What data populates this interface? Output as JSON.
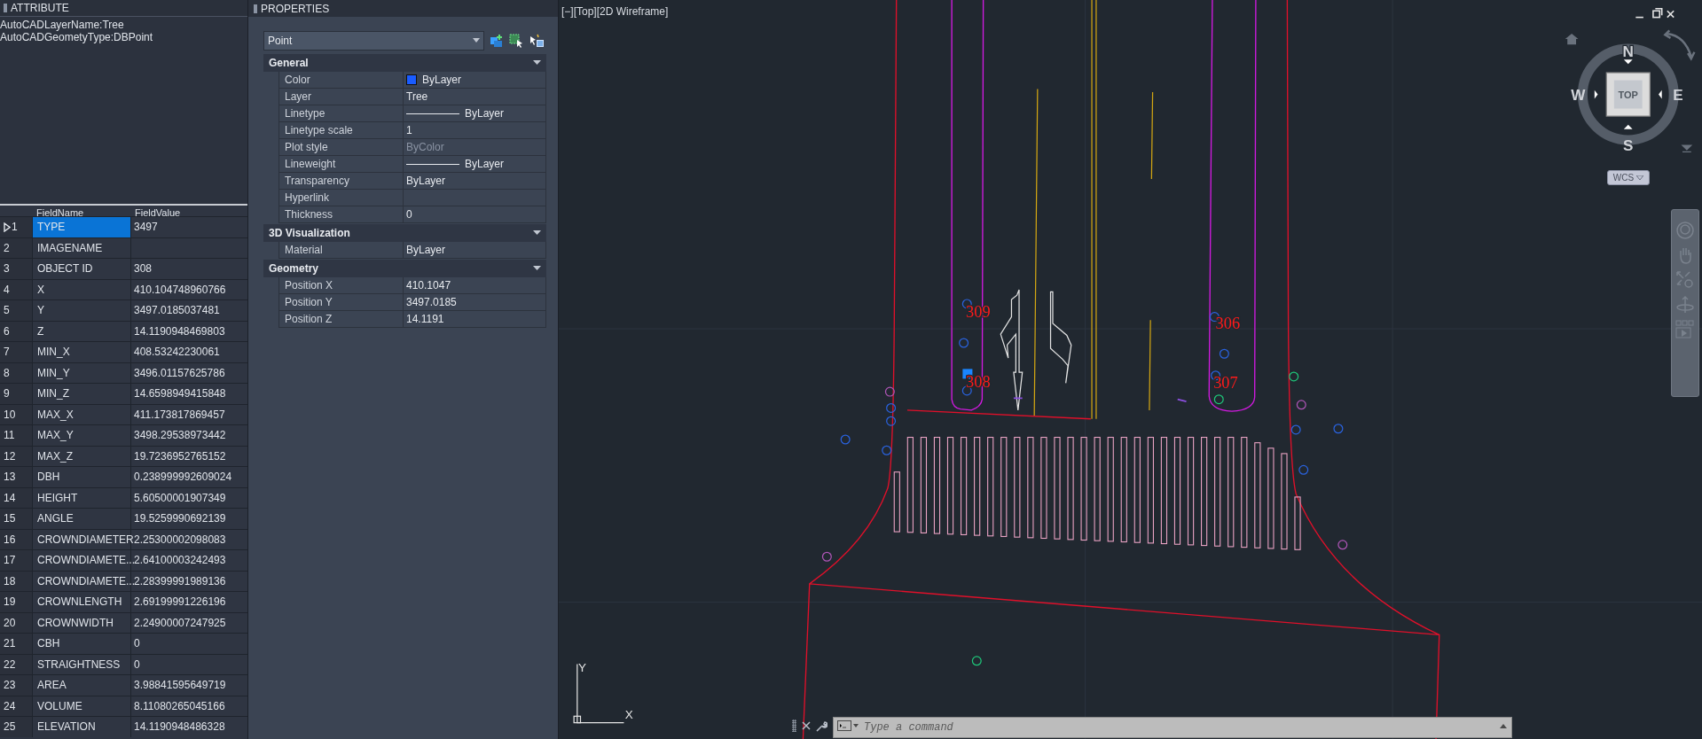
{
  "attribute_panel": {
    "title": "ATTRIBUTE",
    "info_lines": [
      "AutoCADLayerName:Tree",
      "AutoCADGeometyType:DBPoint"
    ],
    "table": {
      "columns": [
        "FieldName",
        "FieldValue"
      ],
      "rows": [
        {
          "number": "1",
          "field_name": "TYPE",
          "field_value": "3497",
          "selected": true
        },
        {
          "number": "2",
          "field_name": "IMAGENAME",
          "selected": false
        },
        {
          "number": "3",
          "field_name": "OBJECT ID",
          "field_value": "308",
          "selected": false
        },
        {
          "number": "4",
          "field_name": "X",
          "field_value": "410.104748960766",
          "selected": false
        },
        {
          "number": "5",
          "field_name": "Y",
          "field_value": "3497.0185037481",
          "selected": false
        },
        {
          "number": "6",
          "field_name": "Z",
          "field_value": "14.1190948469803",
          "selected": false
        },
        {
          "number": "7",
          "field_name": "MIN_X",
          "field_value": "408.53242230061",
          "selected": false
        },
        {
          "number": "8",
          "field_name": "MIN_Y",
          "field_value": "3496.01157625786",
          "selected": false
        },
        {
          "number": "9",
          "field_name": "MIN_Z",
          "field_value": "14.6598949415848",
          "selected": false
        },
        {
          "number": "10",
          "field_name": "MAX_X",
          "field_value": "411.173817869457",
          "selected": false
        },
        {
          "number": "11",
          "field_name": "MAX_Y",
          "field_value": "3498.29538973442",
          "selected": false
        },
        {
          "number": "12",
          "field_name": "MAX_Z",
          "field_value": "19.7236952765152",
          "selected": false
        },
        {
          "number": "13",
          "field_name": "DBH",
          "field_value": "0.238999992609024",
          "selected": false
        },
        {
          "number": "14",
          "field_name": "HEIGHT",
          "field_value": "5.60500001907349",
          "selected": false
        },
        {
          "number": "15",
          "field_name": "ANGLE",
          "field_value": "19.5259990692139",
          "selected": false
        },
        {
          "number": "16",
          "field_name": "CROWNDIAMETER",
          "field_value": "2.25300002098083",
          "selected": false
        },
        {
          "number": "17",
          "field_name": "CROWNDIAMETE...",
          "field_value": "2.64100003242493",
          "selected": false
        },
        {
          "number": "18",
          "field_name": "CROWNDIAMETE...",
          "field_value": "2.28399991989136",
          "selected": false
        },
        {
          "number": "19",
          "field_name": "CROWNLENGTH",
          "field_value": "2.69199991226196",
          "selected": false
        },
        {
          "number": "20",
          "field_name": "CROWNWIDTH",
          "field_value": "2.24900007247925",
          "selected": false
        },
        {
          "number": "21",
          "field_name": "CBH",
          "field_value": "0",
          "selected": false
        },
        {
          "number": "22",
          "field_name": "STRAIGHTNESS",
          "field_value": "0",
          "selected": false
        },
        {
          "number": "23",
          "field_name": "AREA",
          "field_value": "3.98841595649719",
          "selected": false
        },
        {
          "number": "24",
          "field_name": "VOLUME",
          "field_value": "8.11080265045166",
          "selected": false
        },
        {
          "number": "25",
          "field_name": "ELEVATION",
          "field_value": "14.1190948486328",
          "selected": false
        }
      ]
    }
  },
  "properties_panel": {
    "title": "PROPERTIES",
    "object_type": "Point",
    "sections": [
      {
        "title": "General",
        "expanded": true,
        "rows": [
          {
            "kind": "swatch",
            "label": "Color",
            "value": "ByLayer",
            "color": "#1a5cff"
          },
          {
            "kind": "text",
            "label": "Layer",
            "value": "Tree"
          },
          {
            "kind": "line",
            "label": "Linetype",
            "value": "ByLayer"
          },
          {
            "kind": "text",
            "label": "Linetype scale",
            "value": "1"
          },
          {
            "kind": "dimmed",
            "label": "Plot style",
            "value": "ByColor"
          },
          {
            "kind": "line",
            "label": "Lineweight",
            "value": "ByLayer"
          },
          {
            "kind": "text",
            "label": "Transparency",
            "value": "ByLayer"
          },
          {
            "kind": "text",
            "label": "Hyperlink"
          },
          {
            "kind": "text",
            "label": "Thickness",
            "value": "0"
          }
        ]
      },
      {
        "title": "3D Visualization",
        "expanded": true,
        "rows": [
          {
            "kind": "text",
            "label": "Material",
            "value": "ByLayer"
          }
        ]
      },
      {
        "title": "Geometry",
        "expanded": true,
        "rows": [
          {
            "kind": "text",
            "label": "Position X",
            "value": "410.1047"
          },
          {
            "kind": "text",
            "label": "Position Y",
            "value": "3497.0185"
          },
          {
            "kind": "text",
            "label": "Position Z",
            "value": "14.1191"
          }
        ]
      }
    ]
  },
  "viewport": {
    "label": "[−][Top][2D Wireframe]",
    "drawing_labels": [
      "309",
      "308",
      "306",
      "307"
    ],
    "viewcube": {
      "north": "N",
      "south": "S",
      "east": "E",
      "west": "W",
      "face": "TOP"
    },
    "coordinate_system": "WCS",
    "ucs_axes": {
      "x": "X",
      "y": "Y"
    },
    "command_line": {
      "placeholder": "Type a command"
    }
  }
}
